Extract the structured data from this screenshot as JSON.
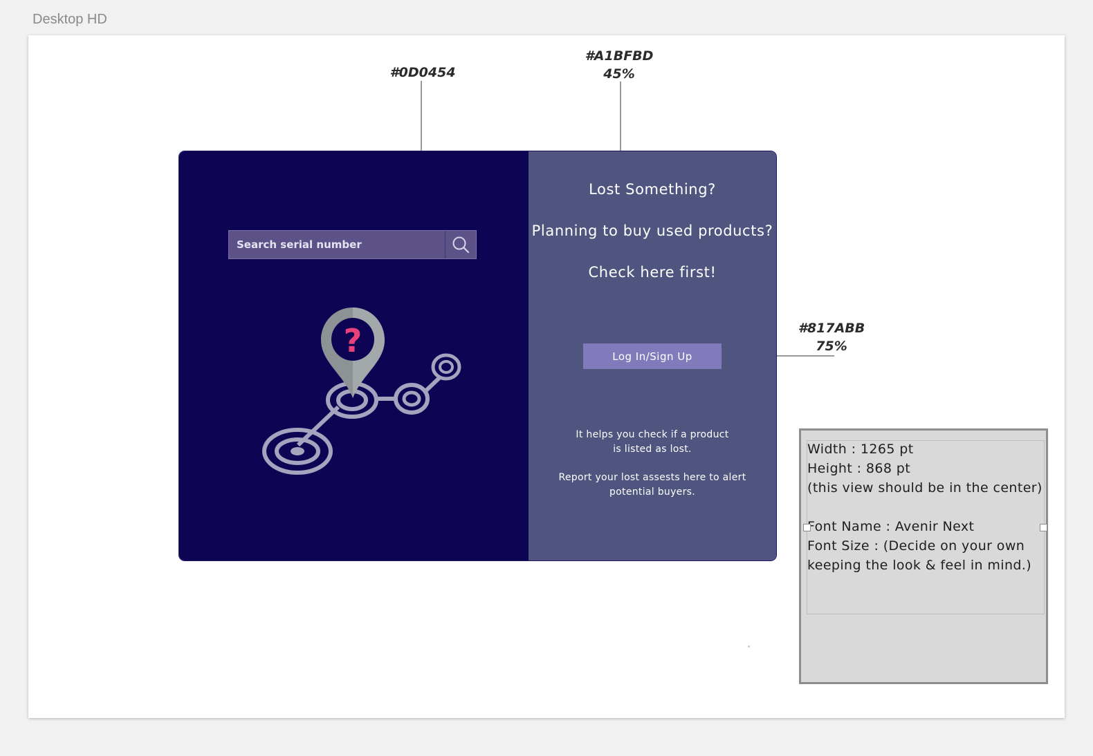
{
  "artboard": {
    "title": "Desktop HD"
  },
  "annotations": {
    "left_color": {
      "hex": "#0D0454"
    },
    "right_color": {
      "hex": "#A1BFBD",
      "opacity": "45%"
    },
    "button_color": {
      "hex": "#817ABB",
      "opacity": "75%"
    }
  },
  "search": {
    "placeholder": "Search serial number"
  },
  "right_panel": {
    "line1": "Lost Something?",
    "line2": "Planning to buy used products?",
    "line3": "Check here first!",
    "button_label": "Log In/Sign Up",
    "info1_line1": "It helps you check if a product",
    "info1_line2": "is listed as lost.",
    "info2_line1": "Report your lost assests here to alert",
    "info2_line2": "potential buyers."
  },
  "spec": {
    "width": "Width : 1265 pt",
    "height": "Height : 868 pt",
    "center_note": "(this view should be in the center)",
    "font_name": "Font Name : Avenir Next",
    "font_size_line1": "Font Size : (Decide on your own",
    "font_size_line2": "keeping the look & feel in mind.)"
  },
  "colors": {
    "left_panel": "#0D0454",
    "right_panel": "#4F557F",
    "button": "#817ABB",
    "search_box": "#5C5287",
    "pin_mark": "#E8407A"
  },
  "icons": [
    "search-icon",
    "location-pin-question-icon"
  ]
}
